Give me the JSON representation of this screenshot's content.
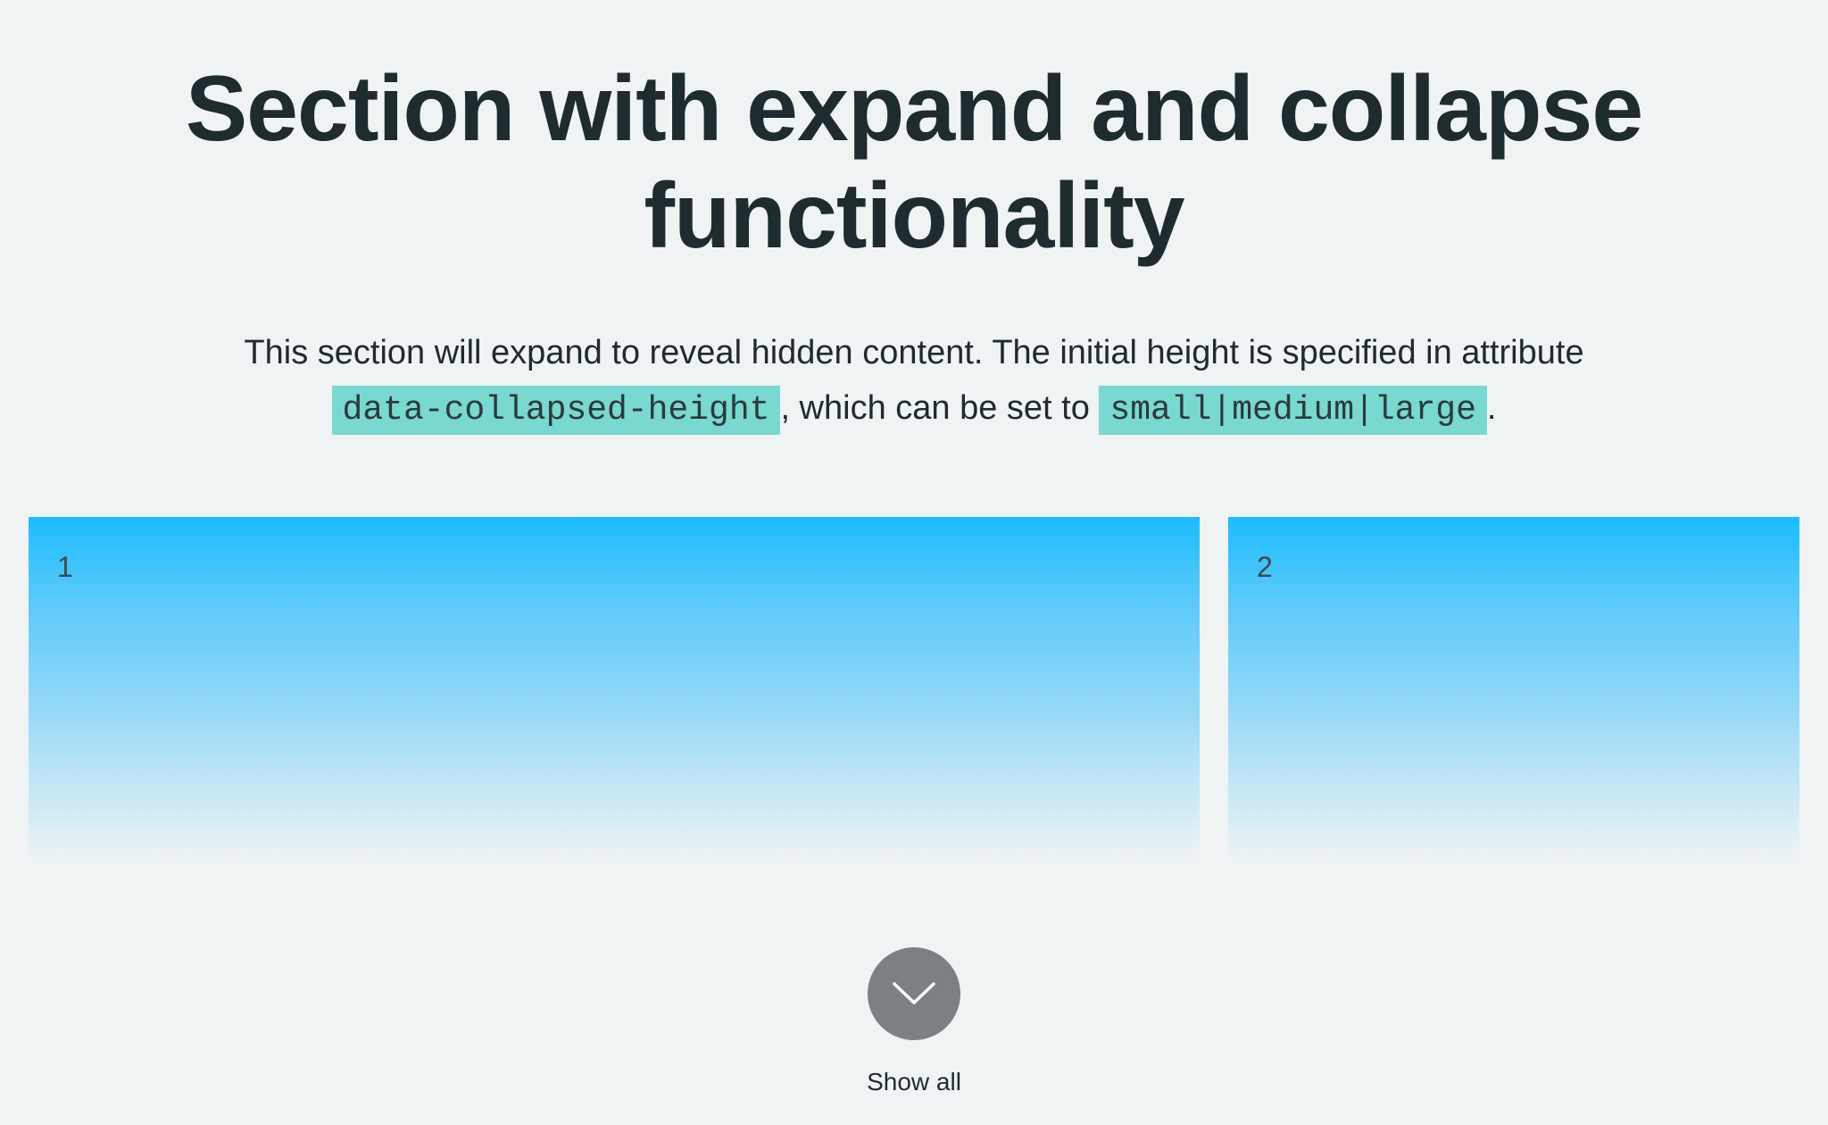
{
  "header": {
    "title": "Section with expand and collapse functionality"
  },
  "description": {
    "text_before_code1": "This section will expand to reveal hidden content. The initial height is specified in attribute",
    "code1": "data-collapsed-height",
    "text_between": ", which can be set to",
    "code2": "small|medium|large",
    "text_after": "."
  },
  "cards": [
    {
      "label": "1"
    },
    {
      "label": "2"
    }
  ],
  "toggle": {
    "icon": "chevron-down-icon",
    "label": "Show all"
  },
  "colors": {
    "background": "#eff3f3",
    "card_gradient_top": "#1cbcfd",
    "code_highlight": "#79d8cf",
    "toggle_button": "#7a8083",
    "text": "#1e2b2f"
  }
}
